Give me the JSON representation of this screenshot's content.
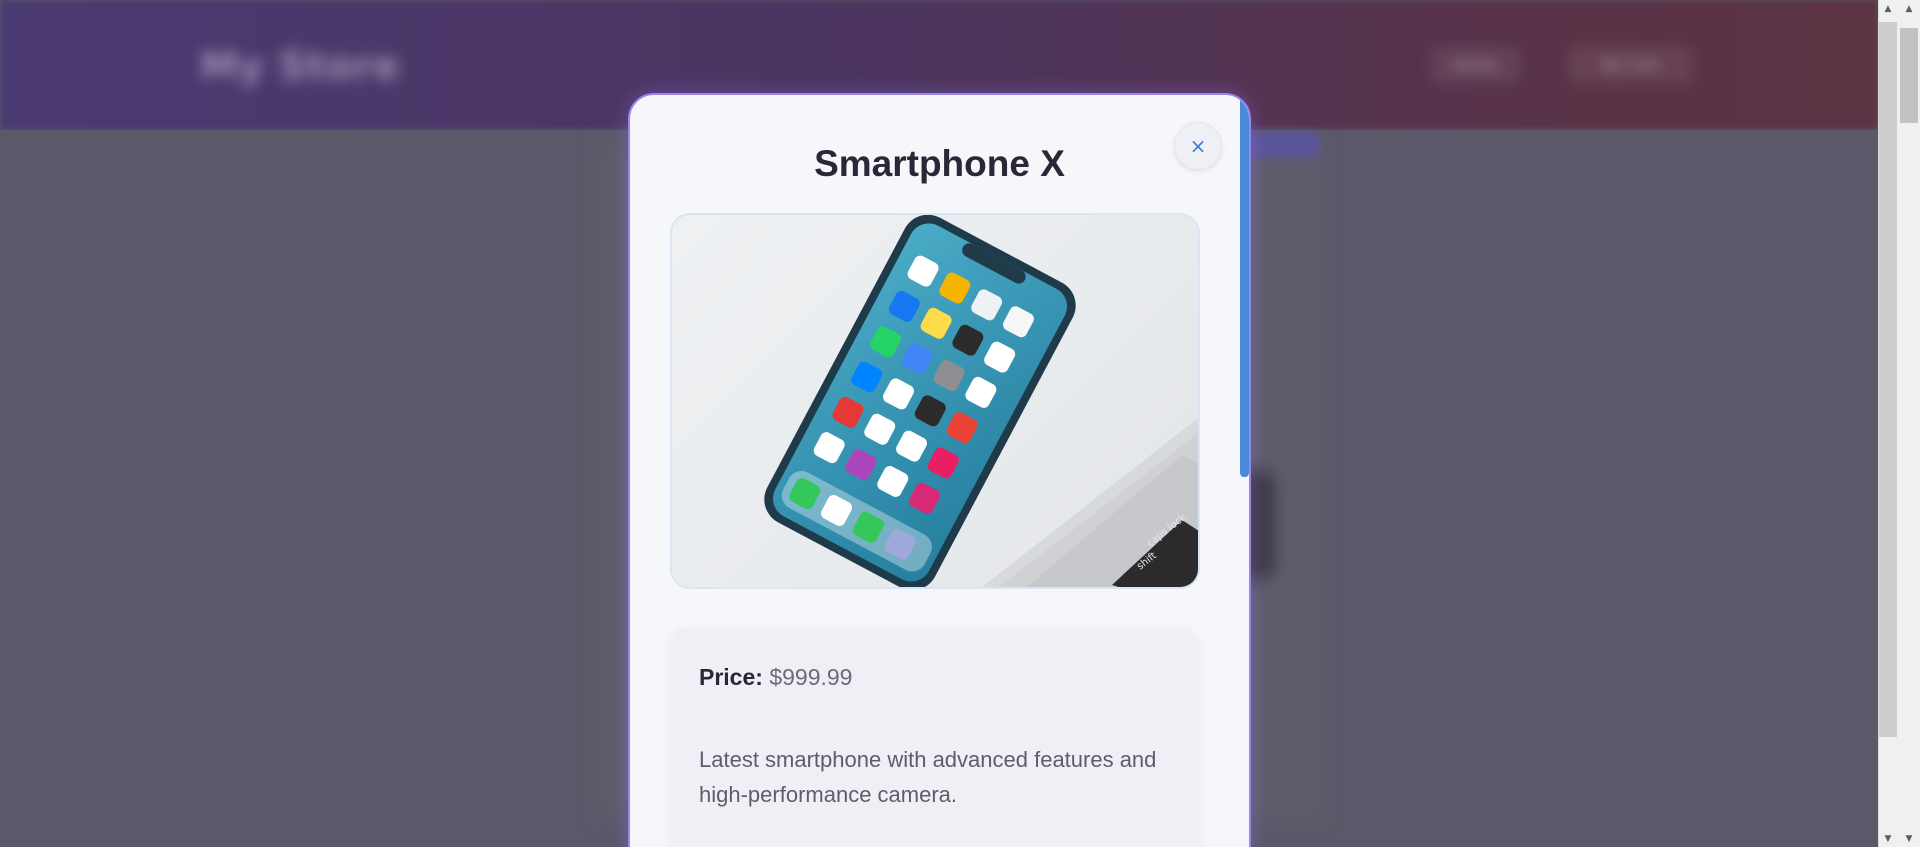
{
  "background": {
    "logo": "My Store",
    "nav": [
      "Home",
      "My Cart"
    ]
  },
  "modal": {
    "title": "Smartphone X",
    "close_label": "×",
    "image_alt": "Smartphone X",
    "price_label": "Price:",
    "price_value": "$999.99",
    "description": "Latest smartphone with advanced features and high-performance camera."
  },
  "colors": {
    "accent": "#4a88d8",
    "modal_border": "#9a86e6",
    "title": "#2a2838"
  },
  "icons": {
    "close": "close-icon",
    "scroll_up": "arrow-up-icon",
    "scroll_down": "arrow-down-icon"
  }
}
